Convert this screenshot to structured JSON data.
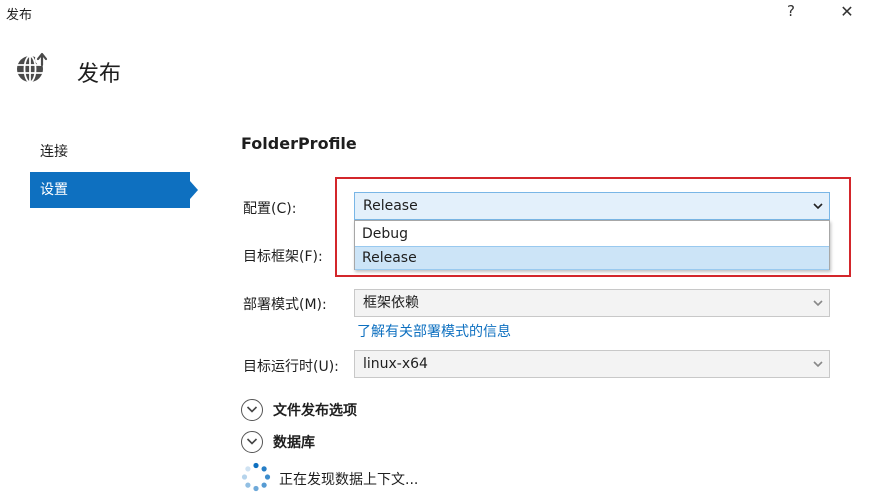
{
  "window": {
    "title": "发布",
    "help_glyph": "?",
    "close_glyph": "✕"
  },
  "header": {
    "title": "发布",
    "icon": "globe-publish-icon"
  },
  "nav": {
    "items": [
      {
        "label": "连接",
        "selected": false
      },
      {
        "label": "设置",
        "selected": true
      }
    ]
  },
  "profile": {
    "name": "FolderProfile"
  },
  "fields": {
    "configuration": {
      "label": "配置(C):",
      "value": "Release",
      "options": [
        "Debug",
        "Release"
      ],
      "highlighted_option": "Release"
    },
    "target_framework": {
      "label": "目标框架(F):"
    },
    "deployment_mode": {
      "label": "部署模式(M):",
      "value": "框架依赖",
      "help_link": "了解有关部署模式的信息"
    },
    "target_runtime": {
      "label": "目标运行时(U):",
      "value": "linux-x64"
    }
  },
  "sections": {
    "file_publish_options": "文件发布选项",
    "databases": "数据库"
  },
  "status": {
    "discovering_text": "正在发现数据上下文..."
  },
  "colors": {
    "accent": "#0e70c0",
    "highlight_border": "#d3262b",
    "option_selected_bg": "#cce4f7"
  }
}
